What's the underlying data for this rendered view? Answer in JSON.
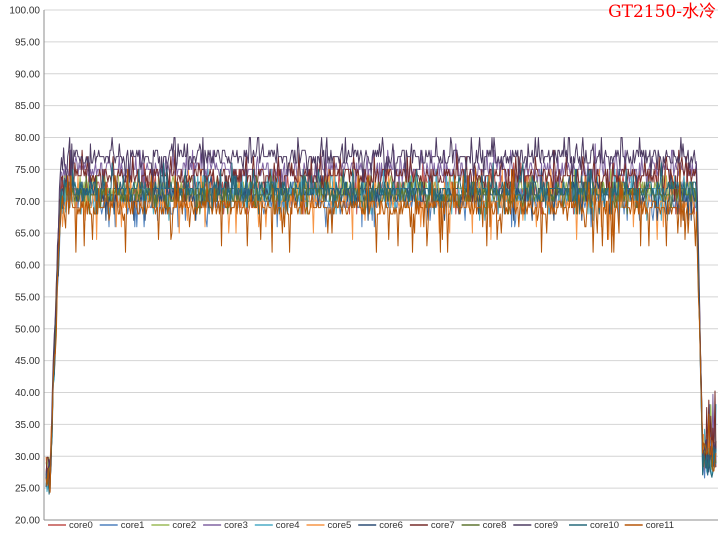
{
  "chart_data": {
    "type": "line",
    "title": "GT2150-水冷",
    "xlabel": "",
    "ylabel": "",
    "ylim": [
      20,
      100
    ],
    "y_ticks": [
      "20.00",
      "25.00",
      "30.00",
      "35.00",
      "40.00",
      "45.00",
      "50.00",
      "55.00",
      "60.00",
      "65.00",
      "70.00",
      "75.00",
      "80.00",
      "85.00",
      "90.00",
      "95.00",
      "100.00"
    ],
    "grid": "horizontal",
    "legend_position": "bottom",
    "x": {
      "count": 650
    },
    "series": [
      {
        "name": "core0",
        "color": "#c0504d",
        "idle": 27,
        "plateau": 72,
        "noise": 3
      },
      {
        "name": "core1",
        "color": "#4f81bd",
        "idle": 26,
        "plateau": 70,
        "noise": 3
      },
      {
        "name": "core2",
        "color": "#9bbb59",
        "idle": 28,
        "plateau": 72,
        "noise": 2
      },
      {
        "name": "core3",
        "color": "#8064a2",
        "idle": 27,
        "plateau": 75,
        "noise": 3
      },
      {
        "name": "core4",
        "color": "#4bacc6",
        "idle": 26,
        "plateau": 71,
        "noise": 3
      },
      {
        "name": "core5",
        "color": "#f79646",
        "idle": 28,
        "plateau": 70,
        "noise": 4
      },
      {
        "name": "core6",
        "color": "#2c4d75",
        "idle": 27,
        "plateau": 71,
        "noise": 3
      },
      {
        "name": "core7",
        "color": "#772c2a",
        "idle": 28,
        "plateau": 74,
        "noise": 3
      },
      {
        "name": "core8",
        "color": "#5f7530",
        "idle": 27,
        "plateau": 71,
        "noise": 2
      },
      {
        "name": "core9",
        "color": "#4d3b62",
        "idle": 28,
        "plateau": 77,
        "noise": 3
      },
      {
        "name": "core10",
        "color": "#276a7c",
        "idle": 26,
        "plateau": 72,
        "noise": 3
      },
      {
        "name": "core11",
        "color": "#b65708",
        "idle": 27,
        "plateau": 69,
        "noise": 5
      }
    ]
  }
}
